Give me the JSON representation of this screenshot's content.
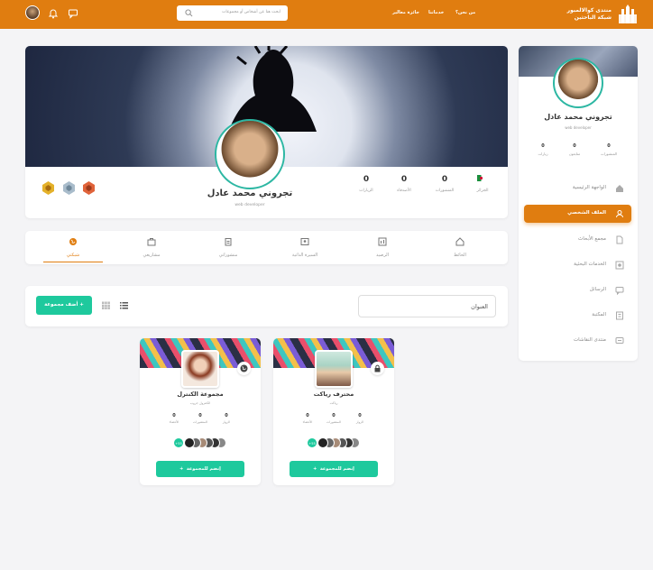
{
  "header": {
    "brand_line1": "منتدى كوالالمبور",
    "brand_line2": "شبكة الباحثين",
    "nav": [
      "من نحن؟",
      "خدماتنا",
      "جائزة معالير"
    ],
    "search_placeholder": "ابحث هنا عن أشخاص أو مجموعات"
  },
  "sidebar": {
    "name": "تجروني محمد عادل",
    "role": "web developer",
    "stats": [
      {
        "value": "0",
        "label": "المنشورات"
      },
      {
        "value": "0",
        "label": "متابعون"
      },
      {
        "value": "0",
        "label": "زيارات"
      }
    ],
    "items": [
      {
        "label": "الواجهة الرئيسية",
        "icon": "home-icon",
        "active": false
      },
      {
        "label": "الملف الشخصي",
        "icon": "user-icon",
        "active": true
      },
      {
        "label": "مجمع الأبحاث",
        "icon": "document-icon",
        "active": false
      },
      {
        "label": "الخدمات البحثية",
        "icon": "services-icon",
        "active": false
      },
      {
        "label": "الرسائل",
        "icon": "messages-icon",
        "active": false
      },
      {
        "label": "المكتبة",
        "icon": "library-icon",
        "active": false
      },
      {
        "label": "منتدى النقاشات",
        "icon": "chat-icon",
        "active": false
      }
    ]
  },
  "profile": {
    "name": "تجروني محمد عادل",
    "role": "web developer",
    "country": "الجزائر",
    "stats": [
      {
        "value": "0",
        "label": "المنشورات"
      },
      {
        "value": "0",
        "label": "الأصدقاء"
      },
      {
        "value": "0",
        "label": "الزيارات"
      }
    ],
    "badges": [
      "badge-gold-icon",
      "badge-silver-icon",
      "badge-bronze-icon"
    ]
  },
  "tabs": [
    {
      "label": "الحائط",
      "icon": "home-icon",
      "active": false
    },
    {
      "label": "الرصيد",
      "icon": "chart-icon",
      "active": false
    },
    {
      "label": "السيرة الذاتية",
      "icon": "id-card-icon",
      "active": false
    },
    {
      "label": "منشوراتي",
      "icon": "clipboard-icon",
      "active": false
    },
    {
      "label": "مشاريعي",
      "icon": "briefcase-icon",
      "active": false
    },
    {
      "label": "شبكتي",
      "icon": "globe-icon",
      "active": true
    }
  ],
  "toolbar": {
    "filter_value": "العنوان",
    "add_button": "أضف مجموعة +"
  },
  "groups": [
    {
      "name": "محترف رياكت",
      "subtitle": "رياكت",
      "privacy_icon": "lock-icon",
      "stats": [
        {
          "value": "0",
          "label": "الزوار"
        },
        {
          "value": "0",
          "label": "المنشورات"
        },
        {
          "value": "0",
          "label": "الأعضاء"
        }
      ],
      "member_count": "+55",
      "join_label": "إنضم للمجموعة"
    },
    {
      "name": "مجموعة الكنترل",
      "subtitle": "الكنترول جروب",
      "privacy_icon": "globe-icon",
      "stats": [
        {
          "value": "0",
          "label": "الزوار"
        },
        {
          "value": "0",
          "label": "المنشورات"
        },
        {
          "value": "0",
          "label": "الأعضاء"
        }
      ],
      "member_count": "+55",
      "join_label": "إنضم للمجموعة"
    }
  ]
}
